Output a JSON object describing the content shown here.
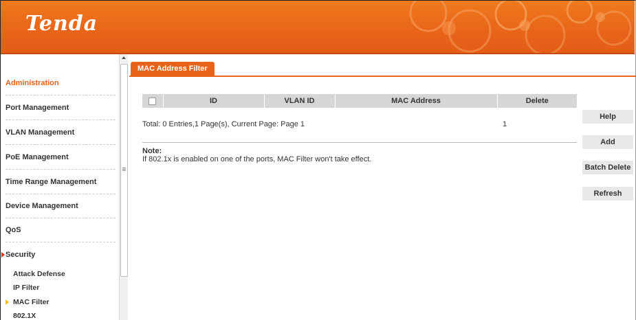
{
  "header": {
    "logo": "Tenda"
  },
  "sidebar": {
    "items": [
      {
        "label": "Administration",
        "active": true
      },
      {
        "label": "Port Management"
      },
      {
        "label": "VLAN Management"
      },
      {
        "label": "PoE Management"
      },
      {
        "label": "Time Range Management"
      },
      {
        "label": "Device Management"
      },
      {
        "label": "QoS"
      },
      {
        "label": "Security",
        "expanded": true
      }
    ],
    "sub_items": [
      {
        "label": "Attack Defense"
      },
      {
        "label": "IP Filter"
      },
      {
        "label": "MAC Filter",
        "selected": true
      },
      {
        "label": "802.1X"
      }
    ]
  },
  "main": {
    "tab": "MAC Address Filter",
    "table": {
      "columns": [
        "ID",
        "VLAN ID",
        "MAC Address",
        "Delete"
      ]
    },
    "total": "Total: 0 Entries,1 Page(s), Current Page: Page 1",
    "page_number": "1",
    "note_title": "Note:",
    "note_text": "If 802.1x is enabled on one of the ports, MAC Filter won't take effect."
  },
  "buttons": {
    "help": "Help",
    "add": "Add",
    "batch_delete": "Batch Delete",
    "refresh": "Refresh"
  },
  "colors": {
    "accent": "#e8641a",
    "header": "#f07a1c"
  }
}
